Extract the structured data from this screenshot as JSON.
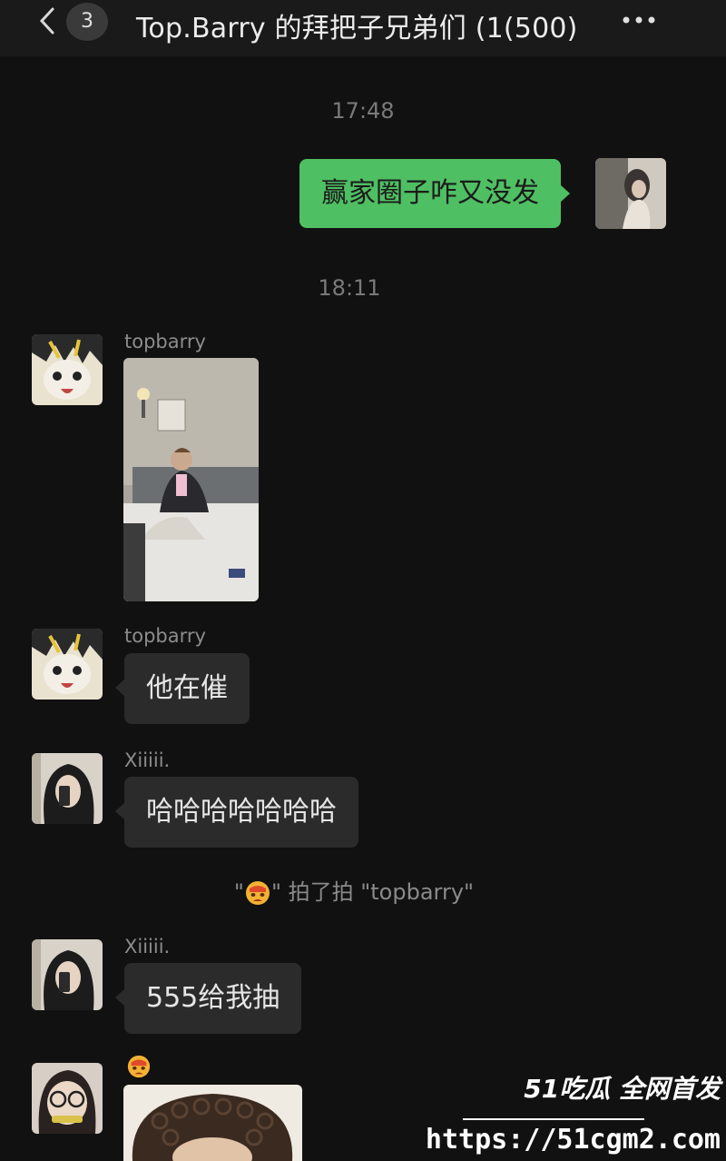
{
  "header": {
    "back_icon": "chevron-left-icon",
    "unread_count": "3",
    "title": "Top.Barry 的拜把子兄弟们 (1",
    "member_count": "(500)",
    "more_icon": "more-dots-icon"
  },
  "messages": [
    {
      "type": "timestamp",
      "text": "17:48"
    },
    {
      "type": "text",
      "from": "me",
      "text": "赢家圈子咋又没发"
    },
    {
      "type": "timestamp",
      "text": "18:11"
    },
    {
      "type": "image",
      "sender": "topbarry"
    },
    {
      "type": "text",
      "sender": "topbarry",
      "text": "他在催"
    },
    {
      "type": "text",
      "sender": "Xiiiii.",
      "text": "哈哈哈哈哈哈哈"
    },
    {
      "type": "system",
      "text_prefix": "\"",
      "text_suffix": "\" 拍了拍 \"topbarry\"",
      "icon": "crying-face-emoji-icon"
    },
    {
      "type": "text",
      "sender": "Xiiiii.",
      "text": "555给我抽"
    },
    {
      "type": "image",
      "sender_icon": "crying-face-emoji-icon"
    }
  ],
  "watermark": {
    "brand": "51吃瓜 全网首发",
    "url": "https://51cgm2.com"
  },
  "colors": {
    "background": "#111111",
    "bubble_other": "#2b2b2b",
    "bubble_mine": "#4fbf63"
  }
}
